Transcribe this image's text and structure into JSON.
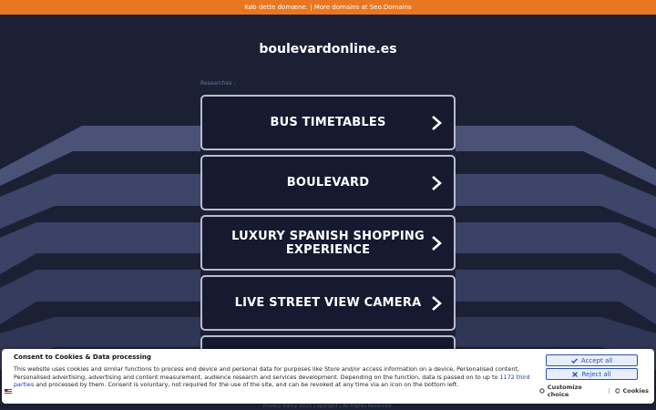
{
  "topbar": {
    "text": "Køb dette domæne. | More domains at Seo.Domains"
  },
  "header": {
    "domain": "boulevardonline.es"
  },
  "main": {
    "section_label": "Researches :",
    "links": [
      {
        "label": "BUS TIMETABLES"
      },
      {
        "label": "BOULEVARD"
      },
      {
        "label": "LUXURY SPANISH SHOPPING EXPERIENCE"
      },
      {
        "label": "LIVE STREET VIEW CAMERA"
      },
      {
        "label": ""
      }
    ]
  },
  "consent": {
    "title": "Consent to Cookies & Data processing",
    "text_before_link": "This website uses cookies and similar functions to process end device and personal data for purposes like Store and/or access information on a device, Personalised content, Personalised advertising, advertising and content measurement, audience research and services development. Depending on the function, data is passed on to up to ",
    "link_text": "1172 third parties",
    "text_after_link": " and processed by them. Consent is voluntary, not required for the use of the site, and can be revoked at any time via an icon on the bottom left.",
    "accept_label": "Accept all",
    "reject_label": "Reject all",
    "customize_label": "Customize choice",
    "separator": "|",
    "cookies_label": "Cookies"
  },
  "footer": {
    "text": "Privacy Policy   2025 Copyright | All Rights Reserved."
  },
  "colors": {
    "background": "#1b2035",
    "topbar": "#e87722",
    "card_border": "#b9bccb",
    "button_blue": "#2b52b5"
  }
}
